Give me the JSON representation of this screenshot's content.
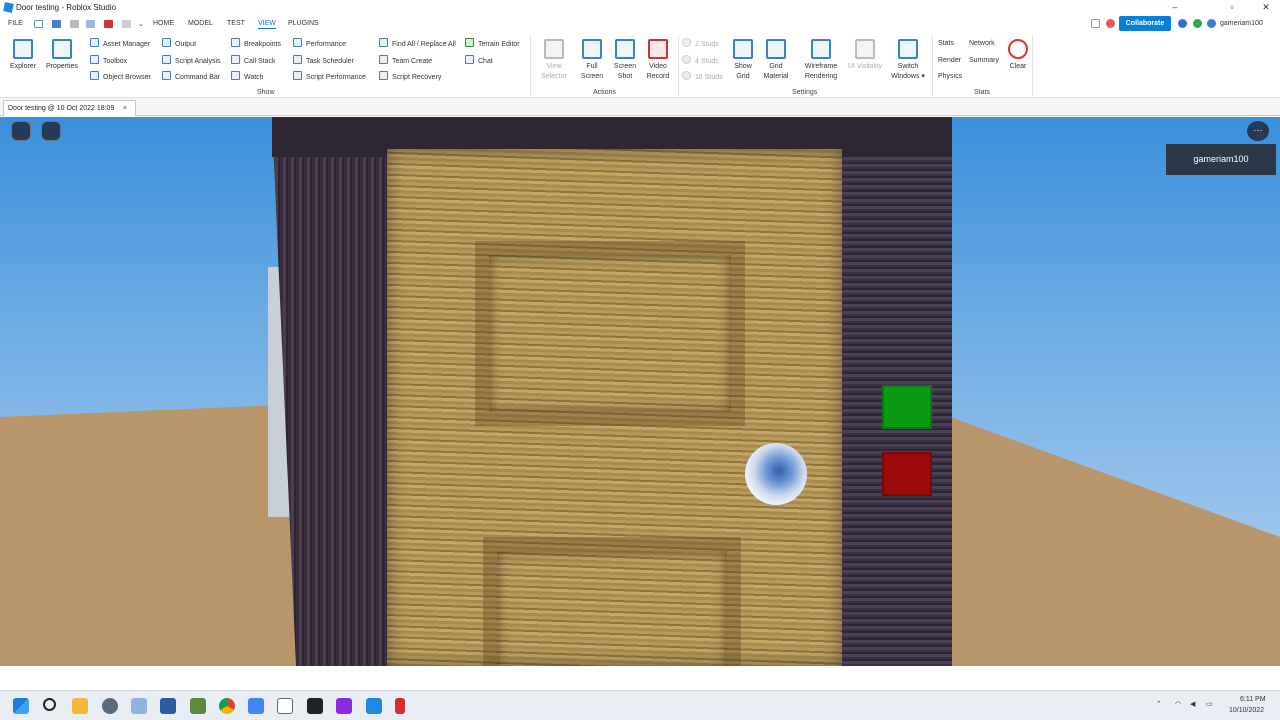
{
  "window": {
    "title": "Door testing - Roblox Studio"
  },
  "menu": {
    "tabs": [
      "FILE",
      "HOME",
      "MODEL",
      "TEST",
      "VIEW",
      "PLUGINS"
    ],
    "active": "VIEW"
  },
  "header_right": {
    "collaborate_label": "Collaborate",
    "username": "gameriam100"
  },
  "ribbon": {
    "show": {
      "explorer": "Explorer",
      "properties": "Properties",
      "asset_manager": "Asset Manager",
      "toolbox": "Toolbox",
      "object_browser": "Object Browser",
      "output": "Output",
      "script_analysis": "Script Analysis",
      "command_bar": "Command Bar",
      "breakpoints": "Breakpoints",
      "call_stack": "Call Stack",
      "watch": "Watch",
      "performance": "Performance",
      "task_scheduler": "Task Scheduler",
      "script_performance": "Script Performance",
      "find_replace_all": "Find All / Replace All",
      "team_create": "Team Create",
      "script_recovery": "Script Recovery",
      "terrain_editor": "Terrain Editor",
      "chat": "Chat",
      "group_label": "Show"
    },
    "actions": {
      "view_selector": [
        "View",
        "Selector"
      ],
      "full_screen": [
        "Full",
        "Screen"
      ],
      "screen_shot": [
        "Screen",
        "Shot"
      ],
      "video_record": [
        "Video",
        "Record"
      ],
      "group_label": "Actions"
    },
    "settings": {
      "studs_2": "2 Studs",
      "studs_4": "4 Studs",
      "studs_16": "16 Studs",
      "show_grid": [
        "Show",
        "Grid"
      ],
      "grid_material": [
        "Grid",
        "Material"
      ],
      "wireframe_rendering": [
        "Wireframe",
        "Rendering"
      ],
      "ui_visibility": "UI Visibility",
      "switch_windows": [
        "Switch",
        "Windows ▾"
      ],
      "group_label": "Settings"
    },
    "stats": {
      "stats": "Stats",
      "network": "Network",
      "render": "Render",
      "summary": "Summary",
      "physics": "Physics",
      "clear": "Clear",
      "group_label": "Stats"
    }
  },
  "doc_tab": {
    "label": "Door testing @ 10 Oct 2022 18:09",
    "close": "×"
  },
  "viewport": {
    "player_name": "gameriam100",
    "menu_glyph": "···"
  },
  "taskbar": {
    "time": "6:11 PM",
    "date": "10/10/2022"
  },
  "colors": {
    "accent": "#0a7fd8",
    "green_button": "#0a9a14",
    "red_button": "#9c0a0a"
  }
}
